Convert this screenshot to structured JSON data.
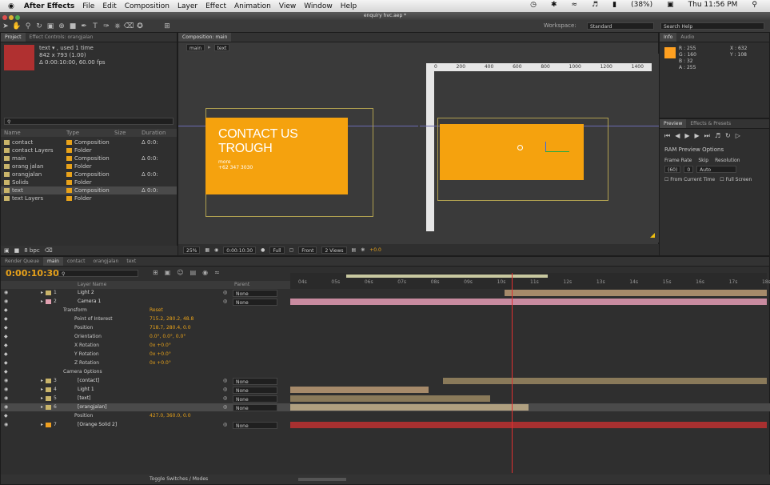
{
  "menubar": {
    "app_name": "After Effects",
    "menus": [
      "File",
      "Edit",
      "Composition",
      "Layer",
      "Effect",
      "Animation",
      "View",
      "Window",
      "Help"
    ],
    "battery": "(38%)",
    "clock": "Thu 11:56 PM"
  },
  "window_title": "enquiry hvc.aep *",
  "workspace": {
    "label": "Workspace:",
    "value": "Standard"
  },
  "search_help_placeholder": "Search Help",
  "project_panel": {
    "tabs": [
      "Project",
      "Effect Controls: orangjalan"
    ],
    "selected_name": "text ▾ , used 1 time",
    "selected_size": "842 x 793 (1.00)",
    "selected_duration": "Δ 0:00:10:00, 60.00 fps",
    "columns": [
      "Name",
      "Type",
      "Size",
      "Duration"
    ],
    "items": [
      {
        "name": "contact",
        "type": "Composition",
        "duration": "Δ 0:0:",
        "color": "#c9b46a",
        "kind": "comp"
      },
      {
        "name": "contact Layers",
        "type": "Folder",
        "duration": "",
        "color": "#c9b46a",
        "kind": "folder"
      },
      {
        "name": "main",
        "type": "Composition",
        "duration": "Δ 0:0:",
        "color": "#c9b46a",
        "kind": "comp"
      },
      {
        "name": "orang jalan",
        "type": "Folder",
        "duration": "",
        "color": "#c9b46a",
        "kind": "folder"
      },
      {
        "name": "orangjalan",
        "type": "Composition",
        "duration": "Δ 0:0:",
        "color": "#c9b46a",
        "kind": "comp"
      },
      {
        "name": "Solids",
        "type": "Folder",
        "duration": "",
        "color": "#c9b46a",
        "kind": "folder"
      },
      {
        "name": "text",
        "type": "Composition",
        "duration": "Δ 0:0:",
        "color": "#c9b46a",
        "kind": "comp",
        "selected": true
      },
      {
        "name": "text Layers",
        "type": "Folder",
        "duration": "",
        "color": "#c9b46a",
        "kind": "folder"
      }
    ],
    "bpc": "8 bpc"
  },
  "comp_panel": {
    "tab": "Composition: main",
    "breadcrumb": [
      "main",
      "text"
    ],
    "contact_title_line1": "CONTACT US",
    "contact_title_line2": "TROUGH",
    "contact_sub1": "more",
    "contact_sub2": "+62  347 3030",
    "zoom": "25%",
    "timecode": "0:00:10:30",
    "resolution": "Full",
    "view": "Front",
    "views": "2 Views",
    "exposure": "+0.0",
    "ruler_marks": [
      "0",
      "200",
      "400",
      "600",
      "800",
      "1000",
      "1200",
      "1400"
    ]
  },
  "info_panel": {
    "tabs": [
      "Info",
      "Audio"
    ],
    "r": "R : 255",
    "g": "G : 160",
    "b": "B : 32",
    "a": "A : 255",
    "x": "X : 632",
    "y": "Y : 108",
    "swatch_color": "#ffa020"
  },
  "preview_panel": {
    "tabs": [
      "Preview",
      "Effects & Presets"
    ],
    "ram_preview": "RAM Preview Options",
    "frame_rate_label": "Frame Rate",
    "skip_label": "Skip",
    "resolution_label": "Resolution",
    "frame_rate": "(60)",
    "skip": "0",
    "resolution": "Auto",
    "from_current": "From Current Time",
    "full_screen": "Full Screen"
  },
  "timeline": {
    "tabs": [
      "Render Queue",
      "main",
      "contact",
      "orangjalan",
      "text"
    ],
    "timecode": "0:00:10:30",
    "columns": [
      "Layer Name",
      "Parent"
    ],
    "time_labels": [
      "04s",
      "05s",
      "06s",
      "07s",
      "08s",
      "09s",
      "10s",
      "11s",
      "12s",
      "13s",
      "14s",
      "15s",
      "16s",
      "17s",
      "18s"
    ],
    "rows": [
      {
        "num": "1",
        "name": "Light 2",
        "parent": "None",
        "color": "#c9b46a",
        "kind": "layer",
        "bar": {
          "start": 0.45,
          "end": 1.0,
          "color": "#a68a6a"
        }
      },
      {
        "num": "2",
        "name": "Camera 1",
        "parent": "None",
        "color": "#e0a0b0",
        "kind": "layer",
        "bar": {
          "start": 0.0,
          "end": 1.0,
          "color": "#c98ba0"
        }
      },
      {
        "num": "",
        "name": "Transform",
        "value": "Reset",
        "kind": "group"
      },
      {
        "num": "",
        "name": "Point of Interest",
        "value": "715.2, 280.2, 48.8",
        "kind": "prop"
      },
      {
        "num": "",
        "name": "Position",
        "value": "718.7, 280.4, 0.0",
        "kind": "prop"
      },
      {
        "num": "",
        "name": "Orientation",
        "value": "0.0°, 0.0°, 0.0°",
        "kind": "prop"
      },
      {
        "num": "",
        "name": "X Rotation",
        "value": "0x +0.0°",
        "kind": "prop"
      },
      {
        "num": "",
        "name": "Y Rotation",
        "value": "0x +0.0°",
        "kind": "prop"
      },
      {
        "num": "",
        "name": "Z Rotation",
        "value": "0x +0.0°",
        "kind": "prop"
      },
      {
        "num": "",
        "name": "Camera Options",
        "value": "",
        "kind": "group"
      },
      {
        "num": "3",
        "name": "[contact]",
        "parent": "None",
        "color": "#c9b46a",
        "kind": "layer",
        "bar": {
          "start": 0.32,
          "end": 1.0,
          "color": "#8a7a5a"
        }
      },
      {
        "num": "4",
        "name": "Light 1",
        "parent": "None",
        "color": "#c9b46a",
        "kind": "layer",
        "bar": {
          "start": 0.0,
          "end": 0.29,
          "color": "#a68a6a"
        }
      },
      {
        "num": "5",
        "name": "[text]",
        "parent": "None",
        "color": "#c9b46a",
        "kind": "layer",
        "bar": {
          "start": 0.0,
          "end": 0.42,
          "color": "#8a7a5a"
        }
      },
      {
        "num": "6",
        "name": "[orangjalan]",
        "parent": "None",
        "color": "#c9b46a",
        "kind": "layer",
        "selected": true,
        "bar": {
          "start": 0.0,
          "end": 0.5,
          "color": "#b0a080"
        }
      },
      {
        "num": "",
        "name": "Position",
        "value": "427.0, 360.0, 0.0",
        "kind": "prop"
      },
      {
        "num": "7",
        "name": "[Orange Solid 2]",
        "parent": "None",
        "color": "#f0a020",
        "kind": "layer",
        "bar": {
          "start": 0.0,
          "end": 1.0,
          "color": "#a83030"
        }
      }
    ],
    "toggle_label": "Toggle Switches / Modes",
    "playhead_fraction": 0.465
  }
}
